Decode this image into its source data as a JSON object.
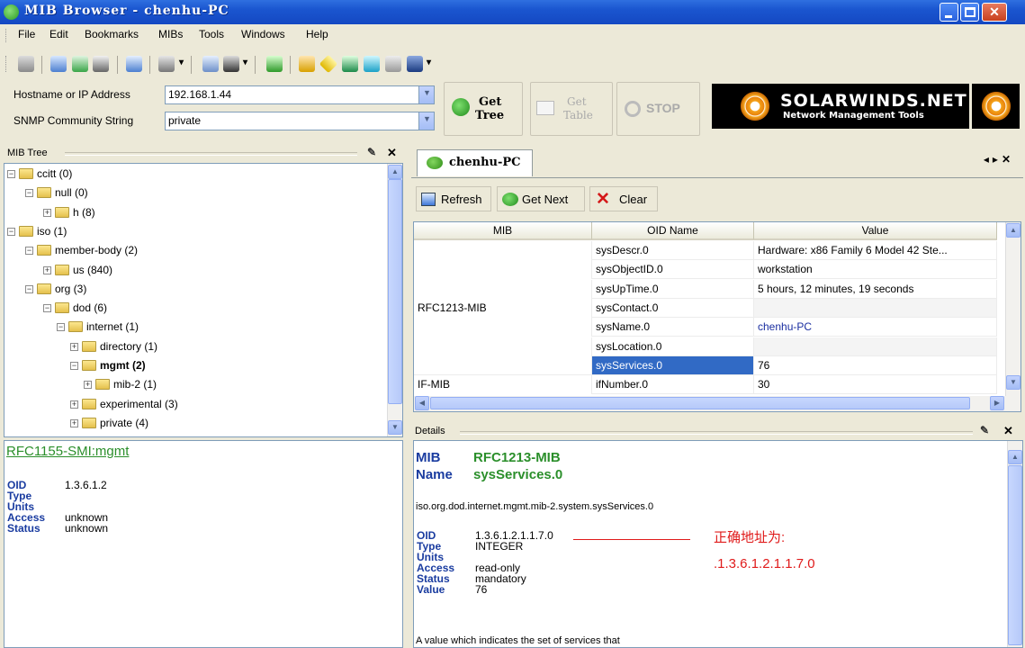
{
  "window": {
    "title": "MIB Browser  -  chenhu-PC"
  },
  "menu": [
    "File",
    "Edit",
    "Bookmarks",
    "MIBs",
    "Tools",
    "Windows",
    "Help"
  ],
  "toolbar_icons": [
    "printer-icon",
    "add-icon",
    "export-icon",
    "find-icon",
    "bookmark-icon",
    "properties-icon",
    "copy-icon",
    "binoculars-icon",
    "graph-icon",
    "speaker-icon",
    "diamond-icon",
    "eye-icon",
    "snmp-icon",
    "window-icon",
    "monitor-icon"
  ],
  "connection": {
    "host_label": "Hostname or IP Address",
    "host_value": "192.168.1.44",
    "community_label": "SNMP Community String",
    "community_value": "private",
    "get_tree": [
      "Get",
      "Tree"
    ],
    "get_table": [
      "Get",
      "Table"
    ],
    "stop": "STOP",
    "banner_title": "SOLARWINDS.NET",
    "banner_sub": "Network Management Tools"
  },
  "mibtree": {
    "label": "MIB Tree",
    "nodes": [
      {
        "expand": "−",
        "text": "ccitt (0)",
        "level": 0,
        "bold": false
      },
      {
        "expand": "−",
        "text": "null (0)",
        "level": 1,
        "bold": false
      },
      {
        "expand": "+",
        "text": "h (8)",
        "level": 2,
        "bold": false
      },
      {
        "expand": "−",
        "text": "iso (1)",
        "level": 0,
        "bold": false
      },
      {
        "expand": "−",
        "text": "member-body (2)",
        "level": 1,
        "bold": false
      },
      {
        "expand": "+",
        "text": "us (840)",
        "level": 2,
        "bold": false
      },
      {
        "expand": "−",
        "text": "org (3)",
        "level": 1,
        "bold": false
      },
      {
        "expand": "−",
        "text": "dod (6)",
        "level": 2,
        "bold": false
      },
      {
        "expand": "−",
        "text": "internet (1)",
        "level": 3,
        "bold": false
      },
      {
        "expand": "+",
        "text": "directory (1)",
        "level": 4,
        "bold": false
      },
      {
        "expand": "−",
        "text": "mgmt (2)",
        "level": 4,
        "bold": true
      },
      {
        "expand": "+",
        "text": "mib-2 (1)",
        "level": 5,
        "bold": false
      },
      {
        "expand": "+",
        "text": "experimental (3)",
        "level": 4,
        "bold": false
      },
      {
        "expand": "+",
        "text": "private (4)",
        "level": 4,
        "bold": false
      }
    ]
  },
  "left_detail": {
    "title": "RFC1155-SMI:mgmt",
    "rows": [
      {
        "k": "OID",
        "v": "1.3.6.1.2"
      },
      {
        "k": "Type",
        "v": ""
      },
      {
        "k": "Units",
        "v": ""
      },
      {
        "k": "Access",
        "v": "unknown"
      },
      {
        "k": "Status",
        "v": "unknown"
      }
    ]
  },
  "tab": {
    "label": "chenhu-PC"
  },
  "actions": {
    "refresh": "Refresh",
    "get_next": "Get Next",
    "clear": "Clear"
  },
  "grid": {
    "headers": [
      "MIB",
      "OID Name",
      "Value"
    ],
    "rows": [
      {
        "mib": "",
        "oid": "sysDescr.0",
        "value": "Hardware: x86 Family 6 Model 42 Ste...",
        "value_blue": false
      },
      {
        "mib": "",
        "oid": "sysObjectID.0",
        "value": "workstation",
        "value_blue": false
      },
      {
        "mib": "",
        "oid": "sysUpTime.0",
        "value": "5 hours, 12 minutes, 19 seconds",
        "value_blue": false
      },
      {
        "mib": "RFC1213-MIB",
        "oid": "sysContact.0",
        "value": "",
        "value_blue": false
      },
      {
        "mib": "",
        "oid": "sysName.0",
        "value": "chenhu-PC",
        "value_blue": true
      },
      {
        "mib": "",
        "oid": "sysLocation.0",
        "value": "",
        "value_blue": false
      },
      {
        "mib": "",
        "oid": "sysServices.0",
        "value": "76",
        "value_blue": false,
        "selected": true
      },
      {
        "mib": "IF-MIB",
        "oid": "ifNumber.0",
        "value": "30",
        "value_blue": false
      }
    ]
  },
  "details": {
    "label": "Details",
    "mib_key": "MIB",
    "mib_val": "RFC1213-MIB",
    "name_key": "Name",
    "name_val": "sysServices.0",
    "path": "iso.org.dod.internet.mgmt.mib-2.system.sysServices.0",
    "rows": [
      {
        "k": "OID",
        "v": "1.3.6.1.2.1.1.7.0"
      },
      {
        "k": "Type",
        "v": "INTEGER"
      },
      {
        "k": "Units",
        "v": ""
      },
      {
        "k": "Access",
        "v": "read-only"
      },
      {
        "k": "Status",
        "v": "mandatory"
      },
      {
        "k": "Value",
        "v": "76"
      }
    ],
    "annotation_line1": "正确地址为:",
    "annotation_line2": ".1.3.6.1.2.1.1.7.0",
    "description": "A value which indicates the set of services that"
  },
  "colors": {
    "titlebar": "#1a55cf",
    "selection": "#316ac5",
    "label_blue": "#1a3ca0",
    "label_green": "#2b8f2b",
    "annotation_red": "#e01b1b"
  }
}
